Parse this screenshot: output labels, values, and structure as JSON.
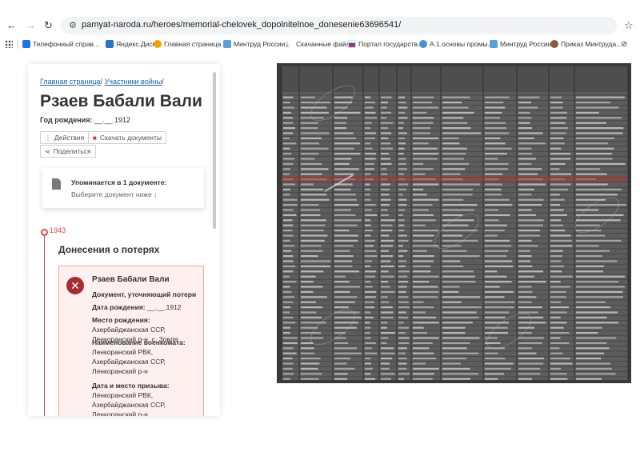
{
  "browser": {
    "url": "pamyat-naroda.ru/heroes/memorial-chelovek_dopolnitelnoe_donesenie63696541/",
    "bookmarks": [
      {
        "label": "Телефонный справ...",
        "color": "#1a73e8"
      },
      {
        "label": "Яндекс.Диск",
        "color": "#2b72c9"
      },
      {
        "label": "Главная страница -...",
        "color": "#f4a100"
      },
      {
        "label": "Минтруд России",
        "color": "#5aa0d8"
      },
      {
        "label": "Скачанные файлы",
        "color": "#555555"
      },
      {
        "label": "Портал государств...",
        "color": "#d93025"
      },
      {
        "label": "А.1.основы промы...",
        "color": "#4a90d9"
      },
      {
        "label": "Минтруд России",
        "color": "#5aa0d8"
      },
      {
        "label": "Приказ Минтруда...",
        "color": "#8a5a3c"
      }
    ]
  },
  "panel": {
    "breadcrumb": {
      "home": "Главная страница",
      "participants": "Участники войны"
    },
    "name": "Рзаев Бабали Вали",
    "birth_label": "Год рождения:",
    "birth_value": "__.__.1912",
    "actions_label": "Действия",
    "download_label": "Скачать документы",
    "share_label": "Поделиться",
    "mention_title": "Упоминается в 1 документе:",
    "mention_hint": "Выберите документ ниже ↓",
    "year": "1943",
    "section_title": "Донесения о потерях",
    "card": {
      "name": "Рзаев Бабали Вали",
      "doc_type": "Документ, уточняющий потери",
      "birth_date_label": "Дата рождения:",
      "birth_date_value": "__.__.1912",
      "birthplace_label": "Место рождения:",
      "birthplace_value": "Азербайджанская ССР, Ленкоранский р-н, с. Зовля",
      "commissariat_label": "Наименование военкомата:",
      "commissariat_value": "Ленкоранский РВК, Азербайджанская ССР, Ленкоранский р-н",
      "draft_label": "Дата и место призыва:",
      "draft_value": "Ленкоранский РВК, Азербайджанская ССР, Ленкоранский р-н"
    }
  },
  "colors": {
    "accent_red": "#d84a4a",
    "link_blue": "#1a62b5",
    "card_bg": "#fdf0ee",
    "highlight_row": "#c03030"
  }
}
